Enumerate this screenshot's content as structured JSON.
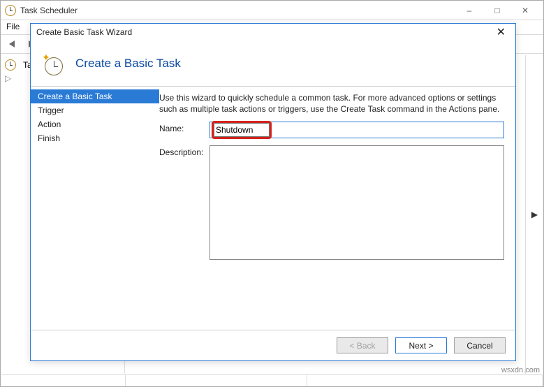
{
  "window": {
    "title": "Task Scheduler",
    "menu": {
      "file": "File"
    },
    "tree": {
      "root": "Task Scheduler"
    }
  },
  "dialog": {
    "frame_title": "Create Basic Task Wizard",
    "header": "Create a Basic Task",
    "steps": {
      "s1": "Create a Basic Task",
      "s2": "Trigger",
      "s3": "Action",
      "s4": "Finish"
    },
    "intro": "Use this wizard to quickly schedule a common task.  For more advanced options or settings such as multiple task actions or triggers, use the Create Task command in the Actions pane.",
    "labels": {
      "name": "Name:",
      "description": "Description:"
    },
    "values": {
      "name": "Shutdown",
      "description": ""
    },
    "buttons": {
      "back": "< Back",
      "next": "Next >",
      "cancel": "Cancel"
    }
  },
  "watermark": "wsxdn.com"
}
